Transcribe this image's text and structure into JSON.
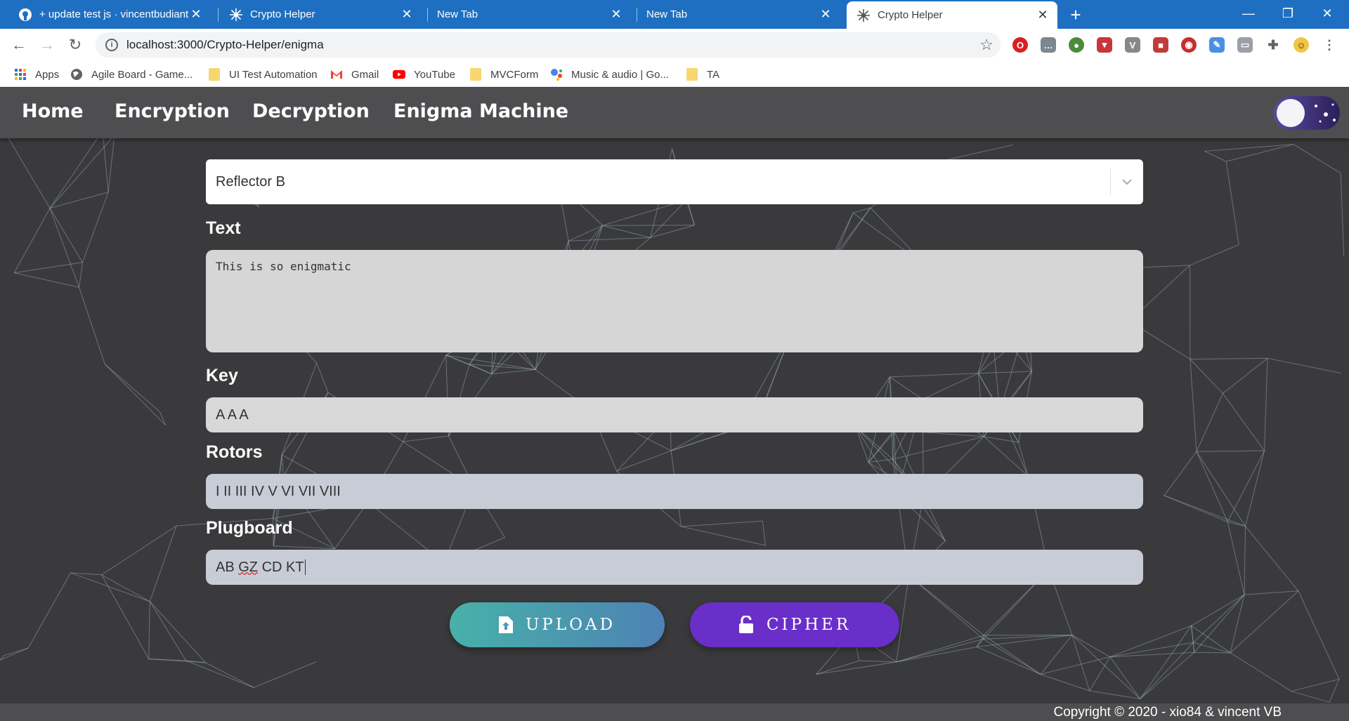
{
  "browser": {
    "tabs": [
      {
        "title": "+ update test js · vincentbudianto",
        "favicon": "github-icon",
        "active": false
      },
      {
        "title": "Crypto Helper",
        "favicon": "crypto-helper-icon",
        "active": false
      },
      {
        "title": "New Tab",
        "favicon": "",
        "active": false
      },
      {
        "title": "New Tab",
        "favicon": "",
        "active": false
      },
      {
        "title": "Crypto Helper",
        "favicon": "crypto-helper-icon",
        "active": true
      }
    ],
    "url": "localhost:3000/Crypto-Helper/enigma",
    "bookmarks": [
      {
        "label": "Apps",
        "icon": "apps-grid-icon"
      },
      {
        "label": "Agile Board - Game...",
        "icon": "globe-icon"
      },
      {
        "label": "UI Test Automation",
        "icon": "folder-icon"
      },
      {
        "label": "Gmail",
        "icon": "gmail-icon"
      },
      {
        "label": "YouTube",
        "icon": "youtube-icon"
      },
      {
        "label": "MVCForm",
        "icon": "folder-icon"
      },
      {
        "label": "Music & audio | Go...",
        "icon": "google-assistant-icon"
      },
      {
        "label": "TA",
        "icon": "folder-icon"
      }
    ]
  },
  "nav": {
    "home": "Home",
    "encryption": "Encryption",
    "decryption": "Decryption",
    "enigma": "Enigma Machine"
  },
  "form": {
    "reflector": "Reflector B",
    "text_label": "Text",
    "text_value": "This is so enigmatic",
    "key_label": "Key",
    "key_value": "A A A",
    "rotors_label": "Rotors",
    "rotors_value": "I II III IV V VI VII VIII",
    "plugboard_label": "Plugboard",
    "plugboard_value_a": "AB ",
    "plugboard_value_b": "GZ",
    "plugboard_value_c": " CD KT"
  },
  "buttons": {
    "upload": "UPLOAD",
    "cipher": "CIPHER"
  },
  "footer": {
    "copyright": "Copyright © 2020 - xio84 & vincent VB"
  },
  "colors": {
    "tabbar": "#1e6fc1",
    "page_bg": "#3a3a3c",
    "navbar": "#4e4e50",
    "upload_gradient_start": "#48b1a9",
    "upload_gradient_end": "#4d82b4",
    "cipher": "#6a2ec9"
  }
}
